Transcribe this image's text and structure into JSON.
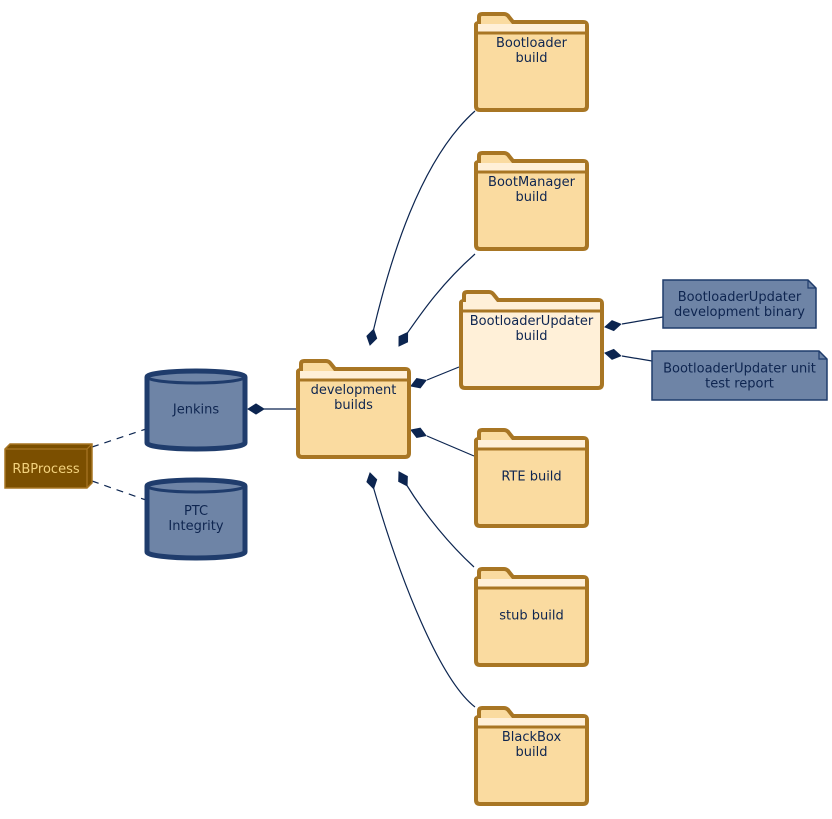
{
  "colors": {
    "folder_fill": "#fadba0",
    "folder_tab_fill": "#fff0d8",
    "folder_stroke": "#a87624",
    "highlight_folder_fill": "#fff0d8",
    "cylinder_fill": "#6e84a6",
    "cylinder_stroke": "#1f3c6c",
    "note_fill": "#6e84a6",
    "note_stroke": "#1f3c6c",
    "node_fill": "#7b4f00",
    "node_text": "#f3d27e",
    "edge": "#0c2550",
    "text": "#0e2550"
  },
  "nodes": {
    "rbprocess": {
      "label": [
        "RBProcess"
      ],
      "shape": "node-box"
    },
    "jenkins": {
      "label": [
        "Jenkins"
      ],
      "shape": "cylinder"
    },
    "ptc": {
      "label": [
        "PTC",
        "Integrity"
      ],
      "shape": "cylinder"
    },
    "dev": {
      "label": [
        "development",
        "builds"
      ],
      "shape": "folder"
    },
    "bootloader": {
      "label": [
        "Bootloader",
        "build"
      ],
      "shape": "folder"
    },
    "bootmanager": {
      "label": [
        "BootManager",
        "build"
      ],
      "shape": "folder"
    },
    "blupdater": {
      "label": [
        "BootloaderUpdater",
        "build"
      ],
      "shape": "folder",
      "highlighted": true
    },
    "rte": {
      "label": [
        "RTE build"
      ],
      "shape": "folder"
    },
    "stub": {
      "label": [
        "stub build"
      ],
      "shape": "folder"
    },
    "blackbox": {
      "label": [
        "BlackBox",
        "build"
      ],
      "shape": "folder"
    },
    "note1": {
      "label": [
        "BootloaderUpdater",
        "development binary"
      ],
      "shape": "note"
    },
    "note2": {
      "label": [
        "BootloaderUpdater unit",
        "test report"
      ],
      "shape": "note"
    }
  },
  "edges": [
    {
      "from": "rbprocess",
      "to": "jenkins",
      "style": "dashed"
    },
    {
      "from": "rbprocess",
      "to": "ptc",
      "style": "dashed"
    },
    {
      "from": "dev",
      "to": "jenkins",
      "style": "composition"
    },
    {
      "from": "bootloader",
      "to": "dev",
      "style": "composition"
    },
    {
      "from": "bootmanager",
      "to": "dev",
      "style": "composition"
    },
    {
      "from": "blupdater",
      "to": "dev",
      "style": "composition"
    },
    {
      "from": "rte",
      "to": "dev",
      "style": "composition"
    },
    {
      "from": "stub",
      "to": "dev",
      "style": "composition"
    },
    {
      "from": "blackbox",
      "to": "dev",
      "style": "composition"
    },
    {
      "from": "note1",
      "to": "blupdater",
      "style": "composition"
    },
    {
      "from": "note2",
      "to": "blupdater",
      "style": "composition"
    }
  ]
}
